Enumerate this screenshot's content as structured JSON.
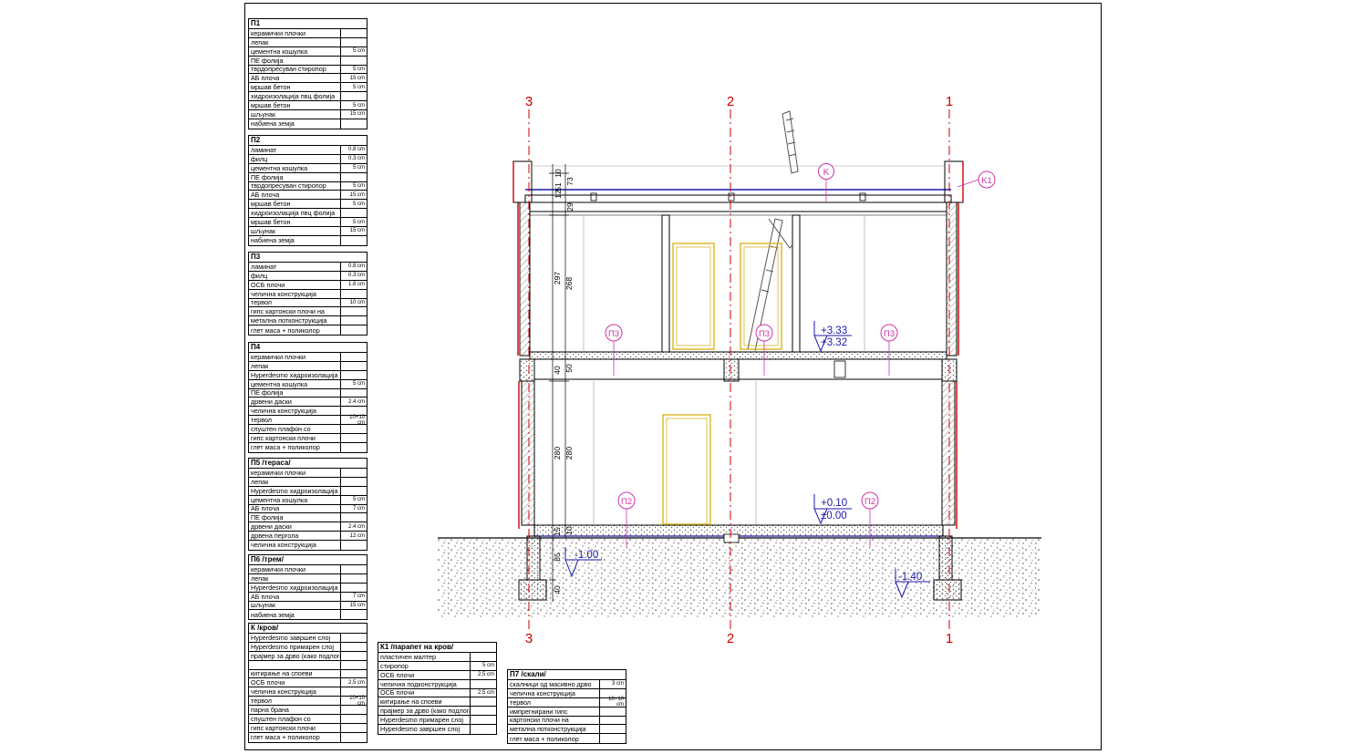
{
  "axes": {
    "top": [
      "3",
      "2",
      "1"
    ],
    "bottom": [
      "3",
      "2",
      "1"
    ]
  },
  "colors": {
    "axis_line": "#cc0000",
    "wall_finish": "#cc0000",
    "insulation_line": "#1a1aa8",
    "level_marker": "#1a1aa8",
    "tag": "#cc33aa",
    "door": "#d9b520",
    "soil_dots": "#444444"
  },
  "tags": {
    "roof": "K",
    "parapet": "K1",
    "floor_upper": "П3",
    "floor_ground": "П2"
  },
  "levels": {
    "upper_top": "+3.33",
    "upper_bottom": "+3.32",
    "ground_top": "+0.10",
    "ground_bottom": "±0.00",
    "foundation": "-1.00",
    "footing": "-1.40"
  },
  "dimensions": {
    "roof_a": "51",
    "roof_b": "73",
    "roof_c": "10",
    "roof_d": "12",
    "roof_slab": "29",
    "upper_height_a": "297",
    "upper_height_b": "268",
    "slab_a": "40",
    "slab_b": "50",
    "ground_height_a": "280",
    "ground_height_b": "280",
    "floor_a": "15",
    "floor_b": "10",
    "found_a": "85",
    "found_b": "40"
  },
  "legend_tables": [
    {
      "title": "П1",
      "rows": [
        [
          "керамички плочки",
          ""
        ],
        [
          "лепак",
          ""
        ],
        [
          "цементна кошулка",
          "5 cm"
        ],
        [
          "ПЕ фолија",
          ""
        ],
        [
          "тврдопресуван стиропор",
          "5 cm"
        ],
        [
          "АБ плоча",
          "15 cm"
        ],
        [
          "мршав бетон",
          "5 cm"
        ],
        [
          "хидроизолација пвц фолија",
          ""
        ],
        [
          "мршав бетон",
          "5 cm"
        ],
        [
          "шљунак",
          "15 cm"
        ],
        [
          "набиена земја",
          ""
        ]
      ]
    },
    {
      "title": "П2",
      "rows": [
        [
          "ламинат",
          "0.8 cm"
        ],
        [
          "филц",
          "0.3 cm"
        ],
        [
          "цементна кошулка",
          "5 cm"
        ],
        [
          "ПЕ фолија",
          ""
        ],
        [
          "тврдопресуван стиропор",
          "5 cm"
        ],
        [
          "АБ плоча",
          "15 cm"
        ],
        [
          "мршав бетон",
          "5 cm"
        ],
        [
          "хидроизолација пвц фолија",
          ""
        ],
        [
          "мршав бетон",
          "5 cm"
        ],
        [
          "шљунак",
          "15 cm"
        ],
        [
          "набиена земја",
          ""
        ]
      ]
    },
    {
      "title": "П3",
      "rows": [
        [
          "ламинат",
          "0.8 cm"
        ],
        [
          "филц",
          "0.3 cm"
        ],
        [
          "ОСБ плочи",
          "1.8 cm"
        ],
        [
          "челична конструкција",
          ""
        ],
        [
          "тервол",
          "10 cm"
        ],
        [
          "гипс картонски плочи на",
          ""
        ],
        [
          "метална потконструкција",
          ""
        ],
        [
          "глет маса + поликолор",
          ""
        ]
      ]
    },
    {
      "title": "П4",
      "rows": [
        [
          "керамички плочки",
          ""
        ],
        [
          "лепак",
          ""
        ],
        [
          "Hyperdesmo хидроизолација",
          ""
        ],
        [
          "цементна кошулка",
          "5 cm"
        ],
        [
          "ПЕ фолија",
          ""
        ],
        [
          "дрвени даски",
          "2.4 cm"
        ],
        [
          "челична конструкција",
          ""
        ],
        [
          "тервол",
          "10+10 cm"
        ],
        [
          "спуштен плафон со",
          ""
        ],
        [
          "гипс картонски плочи",
          ""
        ],
        [
          "глет маса + поликолор",
          ""
        ]
      ]
    },
    {
      "title": "П5 /тераса/",
      "rows": [
        [
          "керамички плочки",
          ""
        ],
        [
          "лепак",
          ""
        ],
        [
          "Hyperdesmo хидроизолација",
          ""
        ],
        [
          "цементна кошулка",
          "5 cm"
        ],
        [
          "АБ плоча",
          "7 cm"
        ],
        [
          "ПЕ фолија",
          ""
        ],
        [
          "дрвени даски",
          "2.4 cm"
        ],
        [
          "дрвена перголa",
          "12 cm"
        ],
        [
          "челична конструкција",
          ""
        ]
      ]
    },
    {
      "title": "П6 /трем/",
      "rows": [
        [
          "керамички плочки",
          ""
        ],
        [
          "лепак",
          ""
        ],
        [
          "Hyperdesmo хидроизолација",
          ""
        ],
        [
          "АБ плоча",
          "7 cm"
        ],
        [
          "шљунак",
          "15 cm"
        ],
        [
          "набиена земја",
          ""
        ]
      ]
    },
    {
      "title": "К /кров/",
      "rows": [
        [
          "Hyperdesmo завршен слој",
          ""
        ],
        [
          "Hyperdesmo примарен слој",
          ""
        ],
        [
          "прајмер за дрво (како подлога за хидроизолација)",
          ""
        ],
        [
          "",
          ""
        ],
        [
          "китирање на споеви",
          ""
        ],
        [
          "ОСБ плочи",
          "2.5 cm"
        ],
        [
          "челична конструкција",
          ""
        ],
        [
          "тервол",
          "10+10 cm"
        ],
        [
          "парна брана",
          ""
        ],
        [
          "спуштен плафон со",
          ""
        ],
        [
          "гипс картонски плочи",
          ""
        ],
        [
          "глет маса + поликолор",
          ""
        ]
      ]
    },
    {
      "title": "К1 /парапет на кров/",
      "rows": [
        [
          "пластичен малтер",
          ""
        ],
        [
          "стиропор",
          "5 cm"
        ],
        [
          "ОСБ плочи",
          "2.5 cm"
        ],
        [
          "челична подконструкција",
          ""
        ],
        [
          "ОСБ плочи",
          "2.5 cm"
        ],
        [
          "китирање на споеви",
          ""
        ],
        [
          "прајмер за дрво (како подлога за хидроизолација)",
          ""
        ],
        [
          "Hyperdesmo примарен слој",
          ""
        ],
        [
          "Hyperdesmo завршен слој",
          ""
        ]
      ]
    },
    {
      "title": "П7 /скали/",
      "rows": [
        [
          "скалници од масивно дрво",
          "3 cm"
        ],
        [
          "челична конструкција",
          ""
        ],
        [
          "тервол",
          "10+10 cm"
        ],
        [
          "импрегнирани гипс",
          ""
        ],
        [
          "картонски плочи на",
          ""
        ],
        [
          "метална потконструкција",
          ""
        ],
        [
          "глет маса + поликолор",
          ""
        ]
      ]
    }
  ]
}
